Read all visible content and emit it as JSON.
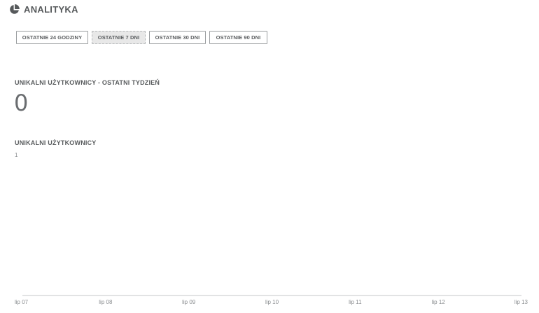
{
  "header": {
    "icon": "pie-chart-icon",
    "title": "ANALITYKA"
  },
  "tabs": [
    {
      "label": "OSTATNIE 24 GODZINY",
      "active": false
    },
    {
      "label": "OSTATNIE 7 DNI",
      "active": true
    },
    {
      "label": "OSTATNIE 30 DNI",
      "active": false
    },
    {
      "label": "OSTATNIE 90 DNI",
      "active": false
    }
  ],
  "weekly": {
    "title": "UNIKALNI UŻYTKOWNICY - OSTATNI TYDZIEŃ",
    "value": "0"
  },
  "chart_data": {
    "type": "line",
    "title": "UNIKALNI UŻYTKOWNICY",
    "categories": [
      "lip 07",
      "lip 08",
      "lip 09",
      "lip 10",
      "lip 11",
      "lip 12",
      "lip 13"
    ],
    "series": [
      {
        "values": [
          0,
          0,
          0,
          0,
          0,
          0,
          0
        ]
      }
    ],
    "y_ticks": [
      "1"
    ],
    "ylim": [
      0,
      1
    ],
    "xlabel": "",
    "ylabel": "",
    "grid": false
  }
}
